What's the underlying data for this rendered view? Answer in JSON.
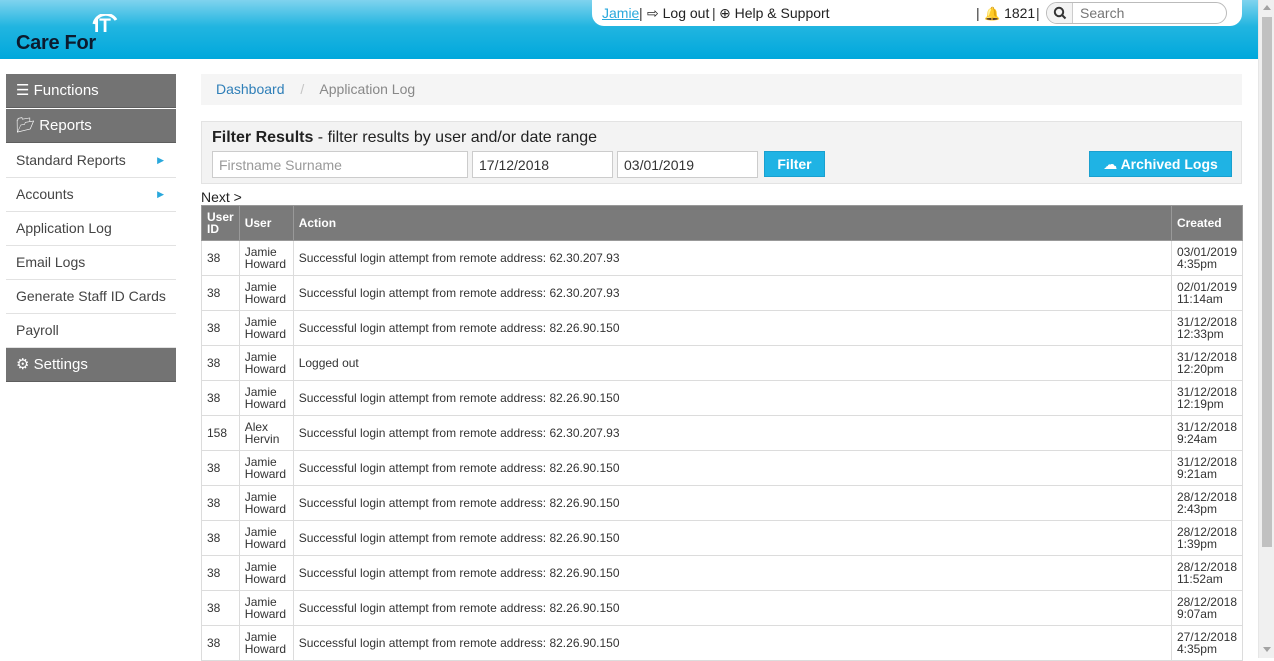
{
  "brand": {
    "name": "Care For",
    "it": "IT"
  },
  "topbar": {
    "user": "Jamie",
    "logout": "Log out",
    "help": "Help & Support",
    "notifications": "1821",
    "search_placeholder": "Search",
    "sep": "|"
  },
  "sidebar": {
    "functions": "Functions",
    "reports": "Reports",
    "items": [
      {
        "label": "Standard Reports",
        "has_submenu": true
      },
      {
        "label": "Accounts",
        "has_submenu": true
      },
      {
        "label": "Application Log",
        "has_submenu": false
      },
      {
        "label": "Email Logs",
        "has_submenu": false
      },
      {
        "label": "Generate Staff ID Cards",
        "has_submenu": false
      },
      {
        "label": "Payroll",
        "has_submenu": false
      }
    ],
    "settings": "Settings"
  },
  "breadcrumb": {
    "home": "Dashboard",
    "divider": "/",
    "current": "Application Log"
  },
  "filter": {
    "title": "Filter Results",
    "subtitle": " - filter results by user and/or date range",
    "name_placeholder": "Firstname Surname",
    "date_from": "17/12/2018",
    "date_to": "03/01/2019",
    "filter_button": "Filter",
    "archived_button": "Archived Logs"
  },
  "pager": {
    "next": "Next >"
  },
  "table": {
    "headers": {
      "user_id_1": "User",
      "user_id_2": "ID",
      "user": "User",
      "action": "Action",
      "created": "Created"
    },
    "rows": [
      {
        "id": "38",
        "first": "Jamie",
        "last": "Howard",
        "action": "Successful login attempt from remote address: 62.30.207.93",
        "date": "03/01/2019",
        "time": "4:35pm"
      },
      {
        "id": "38",
        "first": "Jamie",
        "last": "Howard",
        "action": "Successful login attempt from remote address: 62.30.207.93",
        "date": "02/01/2019",
        "time": "11:14am"
      },
      {
        "id": "38",
        "first": "Jamie",
        "last": "Howard",
        "action": "Successful login attempt from remote address: 82.26.90.150",
        "date": "31/12/2018",
        "time": "12:33pm"
      },
      {
        "id": "38",
        "first": "Jamie",
        "last": "Howard",
        "action": "Logged out",
        "date": "31/12/2018",
        "time": "12:20pm"
      },
      {
        "id": "38",
        "first": "Jamie",
        "last": "Howard",
        "action": "Successful login attempt from remote address: 82.26.90.150",
        "date": "31/12/2018",
        "time": "12:19pm"
      },
      {
        "id": "158",
        "first": "Alex",
        "last": "Hervin",
        "action": "Successful login attempt from remote address: 62.30.207.93",
        "date": "31/12/2018",
        "time": "9:24am"
      },
      {
        "id": "38",
        "first": "Jamie",
        "last": "Howard",
        "action": "Successful login attempt from remote address: 82.26.90.150",
        "date": "31/12/2018",
        "time": "9:21am"
      },
      {
        "id": "38",
        "first": "Jamie",
        "last": "Howard",
        "action": "Successful login attempt from remote address: 82.26.90.150",
        "date": "28/12/2018",
        "time": "2:43pm"
      },
      {
        "id": "38",
        "first": "Jamie",
        "last": "Howard",
        "action": "Successful login attempt from remote address: 82.26.90.150",
        "date": "28/12/2018",
        "time": "1:39pm"
      },
      {
        "id": "38",
        "first": "Jamie",
        "last": "Howard",
        "action": "Successful login attempt from remote address: 82.26.90.150",
        "date": "28/12/2018",
        "time": "11:52am"
      },
      {
        "id": "38",
        "first": "Jamie",
        "last": "Howard",
        "action": "Successful login attempt from remote address: 82.26.90.150",
        "date": "28/12/2018",
        "time": "9:07am"
      },
      {
        "id": "38",
        "first": "Jamie",
        "last": "Howard",
        "action": "Successful login attempt from remote address: 82.26.90.150",
        "date": "27/12/2018",
        "time": "4:35pm"
      }
    ]
  },
  "colors": {
    "accent": "#1fb3e4",
    "header_dark": "#00a8dc",
    "menu_gray": "#737373",
    "bell": "#e01818"
  }
}
